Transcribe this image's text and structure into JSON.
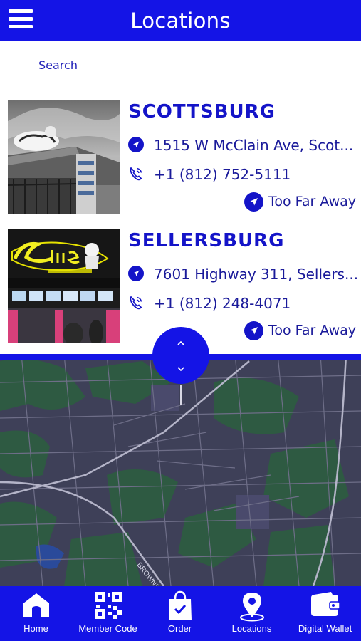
{
  "header": {
    "title": "Locations",
    "menu_icon": "hamburger-menu-icon"
  },
  "search": {
    "label": "Search"
  },
  "colors": {
    "primary": "#1414e6",
    "text": "#1414c8",
    "map": "#3d3f57"
  },
  "locations": [
    {
      "name": "SCOTTSBURG",
      "address": "1515 W McClain Ave, Scot...",
      "phone": "+1 (812) 752-5111",
      "status": "Too Far Away"
    },
    {
      "name": "SELLERSBURG",
      "address": "7601 Highway 311, Sellers...",
      "phone": "+1 (812) 248-4071",
      "status": "Too Far Away"
    }
  ],
  "map": {
    "road_label": "BROWNS"
  },
  "tabs": [
    {
      "label": "Home",
      "icon": "home-icon"
    },
    {
      "label": "Member Code",
      "icon": "qr-code-icon"
    },
    {
      "label": "Order",
      "icon": "shopping-bag-icon"
    },
    {
      "label": "Locations",
      "icon": "map-pin-icon"
    },
    {
      "label": "Digital Wallet",
      "icon": "wallet-icon"
    }
  ]
}
